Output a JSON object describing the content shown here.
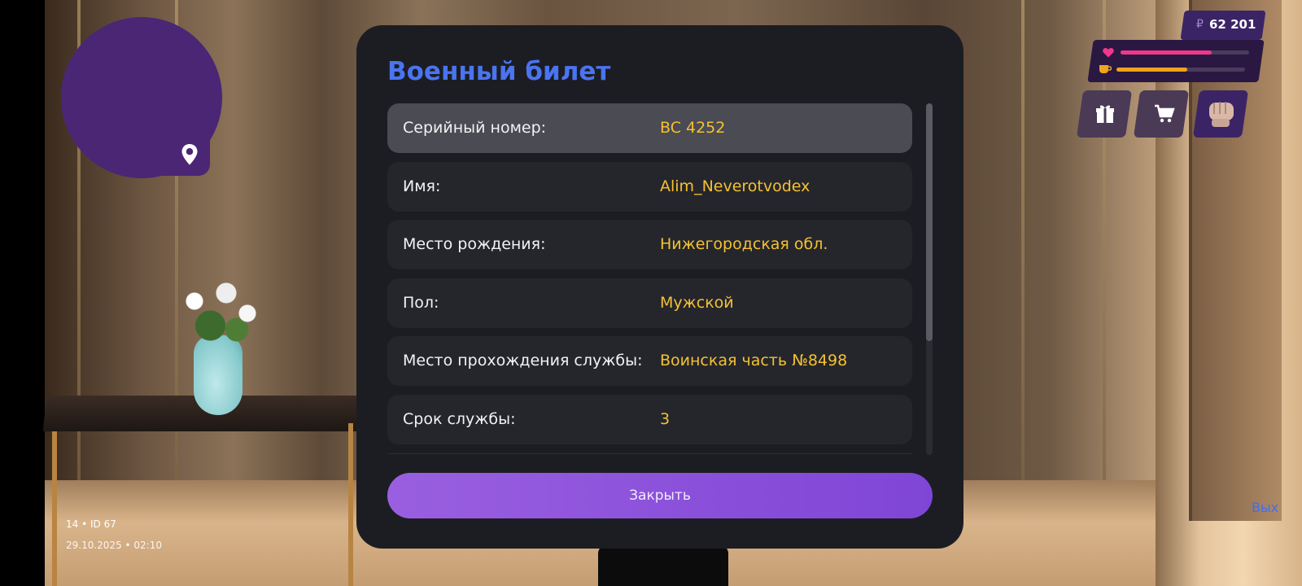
{
  "hud": {
    "money_symbol": "₽",
    "money": "62 201",
    "health_level": 0.71,
    "hunger_level": 0.55,
    "colors": {
      "health": "#f0388a",
      "hunger": "#f0a41c",
      "accent": "#3b2466"
    },
    "buttons": [
      {
        "icon": "gift-icon"
      },
      {
        "icon": "cart-icon"
      },
      {
        "icon": "fist-icon"
      }
    ]
  },
  "minimap": {
    "icon": "location-pin-icon"
  },
  "player": {
    "id_line": "14 • ID 67",
    "datetime": "29.10.2025 • 02:10"
  },
  "offscreen_button": "Вых",
  "document": {
    "title": "Военный билет",
    "rows": [
      {
        "label": "Серийный номер:",
        "value": "BC 4252"
      },
      {
        "label": "Имя:",
        "value": "Alim_Neverotvodex"
      },
      {
        "label": "Место рождения:",
        "value": "Нижегородская обл."
      },
      {
        "label": "Пол:",
        "value": "Мужской"
      },
      {
        "label": "Место прохождения службы:",
        "value": "Воинская часть №8498"
      },
      {
        "label": "Срок службы:",
        "value": "3"
      }
    ],
    "close_label": "Закрыть"
  }
}
